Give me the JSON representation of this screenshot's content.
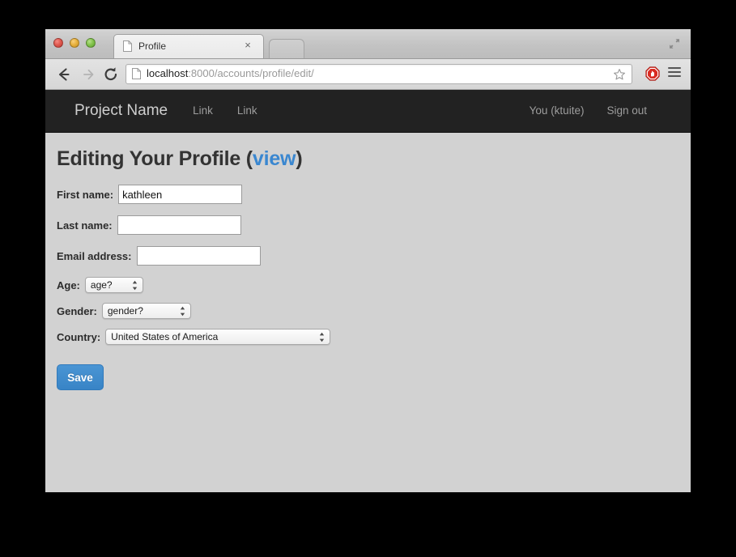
{
  "window": {
    "traffic_lights": [
      "close",
      "minimize",
      "zoom"
    ],
    "fullscreen_icon": "fullscreen-icon"
  },
  "tab": {
    "title": "Profile",
    "favicon": "page-icon",
    "close_label": "×"
  },
  "toolbar": {
    "back_icon": "back-arrow-icon",
    "forward_icon": "forward-arrow-icon",
    "reload_icon": "reload-icon",
    "url_host": "localhost",
    "url_path": ":8000/accounts/profile/edit/",
    "star_icon": "star-icon",
    "extension_icon": "adblock-stop-hand-icon",
    "menu_icon": "hamburger-menu-icon"
  },
  "navbar": {
    "brand": "Project Name",
    "links": [
      {
        "label": "Link"
      },
      {
        "label": "Link"
      }
    ],
    "right_links": [
      {
        "label": "You (ktuite)"
      },
      {
        "label": "Sign out"
      }
    ]
  },
  "page": {
    "title_text": "Editing Your Profile (",
    "title_link": "view",
    "title_tail": ")",
    "fields": [
      {
        "label": "First name:",
        "value": "kathleen",
        "placeholder": ""
      },
      {
        "label": "Last name:",
        "value": "",
        "placeholder": ""
      },
      {
        "label": "Email address:",
        "value": "",
        "placeholder": ""
      }
    ],
    "selects": [
      {
        "label": "Age:",
        "value": "age?"
      },
      {
        "label": "Gender:",
        "value": "gender?"
      },
      {
        "label": "Country:",
        "value": "United States of America"
      }
    ],
    "save_label": "Save"
  },
  "colors": {
    "navbar_bg": "#222222",
    "body_bg": "#d2d2d2",
    "link_blue": "#3a87d0",
    "button_blue": "#3884c6"
  }
}
